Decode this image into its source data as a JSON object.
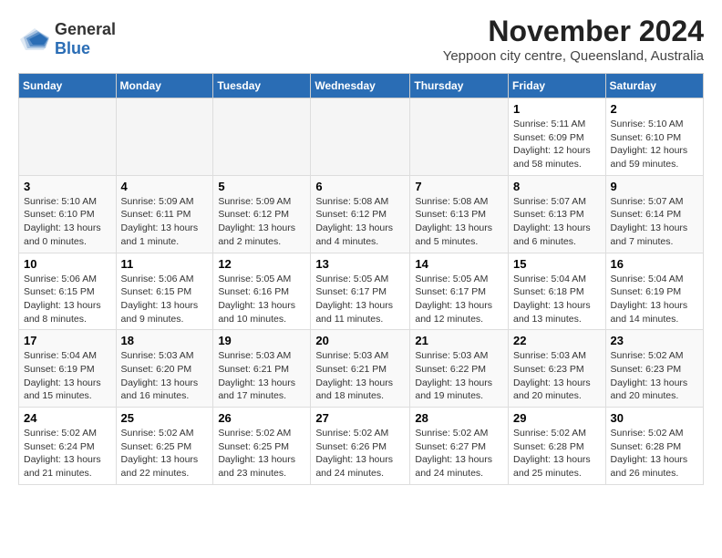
{
  "logo": {
    "general": "General",
    "blue": "Blue"
  },
  "header": {
    "month_title": "November 2024",
    "subtitle": "Yeppoon city centre, Queensland, Australia"
  },
  "weekdays": [
    "Sunday",
    "Monday",
    "Tuesday",
    "Wednesday",
    "Thursday",
    "Friday",
    "Saturday"
  ],
  "weeks": [
    [
      {
        "day": "",
        "empty": true
      },
      {
        "day": "",
        "empty": true
      },
      {
        "day": "",
        "empty": true
      },
      {
        "day": "",
        "empty": true
      },
      {
        "day": "",
        "empty": true
      },
      {
        "day": "1",
        "sunrise": "5:11 AM",
        "sunset": "6:09 PM",
        "daylight": "12 hours and 58 minutes."
      },
      {
        "day": "2",
        "sunrise": "5:10 AM",
        "sunset": "6:10 PM",
        "daylight": "12 hours and 59 minutes."
      }
    ],
    [
      {
        "day": "3",
        "sunrise": "5:10 AM",
        "sunset": "6:10 PM",
        "daylight": "13 hours and 0 minutes."
      },
      {
        "day": "4",
        "sunrise": "5:09 AM",
        "sunset": "6:11 PM",
        "daylight": "13 hours and 1 minute."
      },
      {
        "day": "5",
        "sunrise": "5:09 AM",
        "sunset": "6:12 PM",
        "daylight": "13 hours and 2 minutes."
      },
      {
        "day": "6",
        "sunrise": "5:08 AM",
        "sunset": "6:12 PM",
        "daylight": "13 hours and 4 minutes."
      },
      {
        "day": "7",
        "sunrise": "5:08 AM",
        "sunset": "6:13 PM",
        "daylight": "13 hours and 5 minutes."
      },
      {
        "day": "8",
        "sunrise": "5:07 AM",
        "sunset": "6:13 PM",
        "daylight": "13 hours and 6 minutes."
      },
      {
        "day": "9",
        "sunrise": "5:07 AM",
        "sunset": "6:14 PM",
        "daylight": "13 hours and 7 minutes."
      }
    ],
    [
      {
        "day": "10",
        "sunrise": "5:06 AM",
        "sunset": "6:15 PM",
        "daylight": "13 hours and 8 minutes."
      },
      {
        "day": "11",
        "sunrise": "5:06 AM",
        "sunset": "6:15 PM",
        "daylight": "13 hours and 9 minutes."
      },
      {
        "day": "12",
        "sunrise": "5:05 AM",
        "sunset": "6:16 PM",
        "daylight": "13 hours and 10 minutes."
      },
      {
        "day": "13",
        "sunrise": "5:05 AM",
        "sunset": "6:17 PM",
        "daylight": "13 hours and 11 minutes."
      },
      {
        "day": "14",
        "sunrise": "5:05 AM",
        "sunset": "6:17 PM",
        "daylight": "13 hours and 12 minutes."
      },
      {
        "day": "15",
        "sunrise": "5:04 AM",
        "sunset": "6:18 PM",
        "daylight": "13 hours and 13 minutes."
      },
      {
        "day": "16",
        "sunrise": "5:04 AM",
        "sunset": "6:19 PM",
        "daylight": "13 hours and 14 minutes."
      }
    ],
    [
      {
        "day": "17",
        "sunrise": "5:04 AM",
        "sunset": "6:19 PM",
        "daylight": "13 hours and 15 minutes."
      },
      {
        "day": "18",
        "sunrise": "5:03 AM",
        "sunset": "6:20 PM",
        "daylight": "13 hours and 16 minutes."
      },
      {
        "day": "19",
        "sunrise": "5:03 AM",
        "sunset": "6:21 PM",
        "daylight": "13 hours and 17 minutes."
      },
      {
        "day": "20",
        "sunrise": "5:03 AM",
        "sunset": "6:21 PM",
        "daylight": "13 hours and 18 minutes."
      },
      {
        "day": "21",
        "sunrise": "5:03 AM",
        "sunset": "6:22 PM",
        "daylight": "13 hours and 19 minutes."
      },
      {
        "day": "22",
        "sunrise": "5:03 AM",
        "sunset": "6:23 PM",
        "daylight": "13 hours and 20 minutes."
      },
      {
        "day": "23",
        "sunrise": "5:02 AM",
        "sunset": "6:23 PM",
        "daylight": "13 hours and 20 minutes."
      }
    ],
    [
      {
        "day": "24",
        "sunrise": "5:02 AM",
        "sunset": "6:24 PM",
        "daylight": "13 hours and 21 minutes."
      },
      {
        "day": "25",
        "sunrise": "5:02 AM",
        "sunset": "6:25 PM",
        "daylight": "13 hours and 22 minutes."
      },
      {
        "day": "26",
        "sunrise": "5:02 AM",
        "sunset": "6:25 PM",
        "daylight": "13 hours and 23 minutes."
      },
      {
        "day": "27",
        "sunrise": "5:02 AM",
        "sunset": "6:26 PM",
        "daylight": "13 hours and 24 minutes."
      },
      {
        "day": "28",
        "sunrise": "5:02 AM",
        "sunset": "6:27 PM",
        "daylight": "13 hours and 24 minutes."
      },
      {
        "day": "29",
        "sunrise": "5:02 AM",
        "sunset": "6:28 PM",
        "daylight": "13 hours and 25 minutes."
      },
      {
        "day": "30",
        "sunrise": "5:02 AM",
        "sunset": "6:28 PM",
        "daylight": "13 hours and 26 minutes."
      }
    ]
  ]
}
